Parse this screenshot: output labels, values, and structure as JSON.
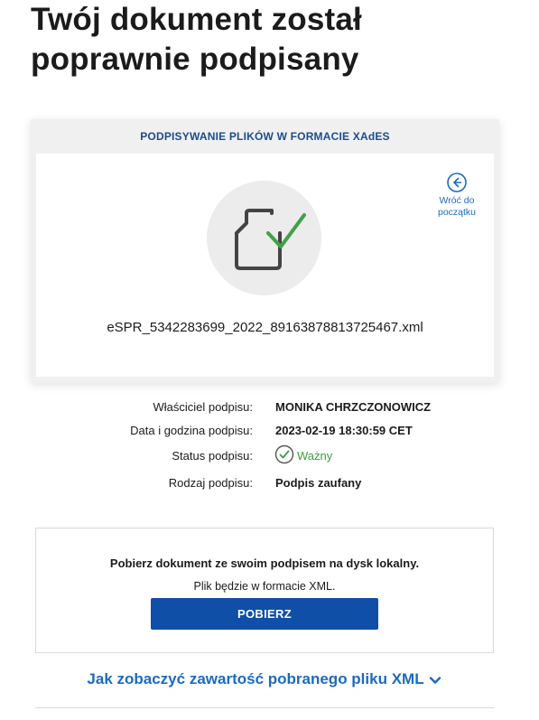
{
  "page": {
    "title": "Twój dokument został poprawnie podpisany"
  },
  "card": {
    "header": "PODPISYWANIE PLIKÓW W FORMACIE XAdES",
    "file_name": "eSPR_5342283699_2022_89163878813725467.xml",
    "back_label_line1": "Wróć do",
    "back_label_line2": "początku",
    "icons": {
      "file": "file-check-icon",
      "back": "arrow-left-circle-icon"
    }
  },
  "details": {
    "owner_label": "Właściciel podpisu:",
    "owner_value": "MONIKA CHRZCZONOWICZ",
    "datetime_label": "Data i godzina podpisu:",
    "datetime_value": "2023-02-19 18:30:59 CET",
    "status_label": "Status podpisu:",
    "status_value": "Ważny",
    "type_label": "Rodzaj podpisu:",
    "type_value": "Podpis zaufany"
  },
  "download": {
    "title": "Pobierz dokument ze swoim podpisem na dysk lokalny.",
    "note": "Plik będzie w formacie XML.",
    "button_label": "POBIERZ"
  },
  "xml_toggle": {
    "label": "Jak zobaczyć zawartość pobranego pliku XML"
  },
  "colors": {
    "accent_blue": "#0f4fa8",
    "link_blue": "#1c6bbf",
    "header_blue": "#1c4b8c",
    "success_green": "#3aa03a"
  }
}
